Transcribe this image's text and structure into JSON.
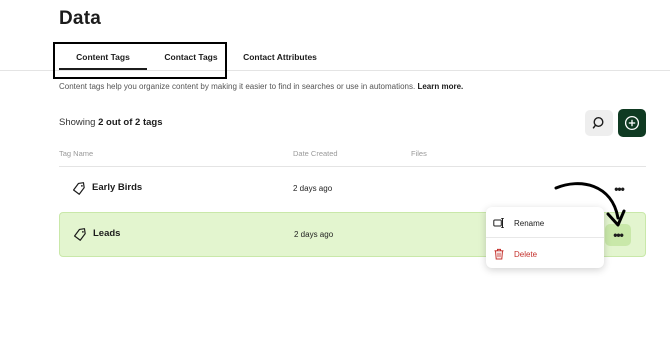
{
  "page": {
    "title": "Data"
  },
  "tabs": [
    {
      "label": "Content Tags",
      "active": true
    },
    {
      "label": "Contact Tags",
      "active": false
    },
    {
      "label": "Contact Attributes",
      "active": false
    }
  ],
  "helper": {
    "text": "Content tags help you organize content by making it easier to find in searches or use in automations.",
    "link": "Learn more."
  },
  "summary": {
    "prefix": "Showing",
    "count": "2 out of 2 tags"
  },
  "toolbar": {
    "search_icon": "search-icon",
    "add_icon": "plus-circle-icon",
    "add_color": "#0f3a22"
  },
  "table": {
    "columns": [
      "Tag Name",
      "Date Created",
      "Files"
    ],
    "rows": [
      {
        "name": "Early Birds",
        "date": "2 days ago",
        "files": "",
        "selected": false
      },
      {
        "name": "Leads",
        "date": "2 days ago",
        "files": "",
        "selected": true
      }
    ],
    "selected_row_color": "#e3f5cf"
  },
  "row_actions": {
    "label": "•••"
  },
  "context_menu": {
    "items": [
      {
        "label": "Rename",
        "icon": "rename-icon"
      },
      {
        "label": "Delete",
        "icon": "trash-icon",
        "color": "#c4312c"
      }
    ]
  }
}
